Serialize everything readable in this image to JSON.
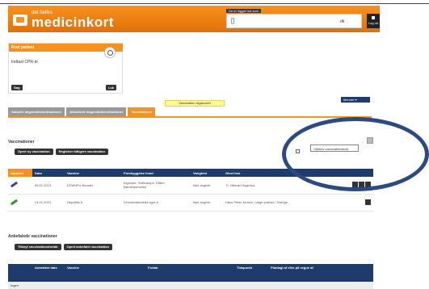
{
  "header": {
    "logo_small": "det fælles",
    "logo_big": "medicinkort",
    "login_tab": "Du er logget ind som",
    "login_suffix": "dk",
    "logout_label": "Log ud"
  },
  "find_patient": {
    "title": "Find patient",
    "cpr_label": "Indtast CPR-nr",
    "search_button": "Søg",
    "close_button": "Luk"
  },
  "toast": "Vaccination registreret",
  "menu_button": "Menuer ▾",
  "tabs": [
    {
      "label": "Aktuelle lægemiddelordinationer",
      "active": false
    },
    {
      "label": "Afsluttede lægemiddelordinationer",
      "active": false
    },
    {
      "label": "Vaccinationer",
      "active": true
    }
  ],
  "vaccinations": {
    "title": "Vaccinationer",
    "buttons": [
      "Opret ny vaccination",
      "Registrer tidligere vaccination"
    ],
    "tooltip": "Udskriv vaccinationskort",
    "checkbox_label": "",
    "columns": [
      "Vaccinéi",
      "Dato",
      "Vaccine",
      "Forebyggelse imod",
      "Varighed",
      "Givet hos"
    ],
    "rows": [
      {
        "icon": "blue",
        "dato": "09.01.2013",
        "vaccine": "DiTeKiPol Booster",
        "imod": "Kighoste, Stivkrampe, Difteri, Børnelammelse",
        "varighed": "Ikke angivet",
        "givet": "TI, Hillerød Sygehus",
        "actions": 3
      },
      {
        "icon": "green",
        "dato": "24.01.2013",
        "vaccine": "Hepatitis A",
        "imod": "Leverbetændelse type A",
        "varighed": "Ikke angivet",
        "givet": "Hans Peter Jensen, Læge praksis i Sverige",
        "actions": 1
      }
    ]
  },
  "recommended": {
    "title": "Anbefalede vaccinationer",
    "buttons": [
      "Tilknyt vaccinationsforløb",
      "Opret anbefalet vaccination"
    ],
    "columns": [
      "Anbefalet dato",
      "Vaccine",
      "Forløb",
      "Tidspunkt",
      "Planlagt af eller på vegne af"
    ],
    "first_cell": "Ingen"
  },
  "colors": {
    "orange": "#f7921e",
    "navy": "#1f3b6b",
    "annotation": "#2b4a80"
  }
}
